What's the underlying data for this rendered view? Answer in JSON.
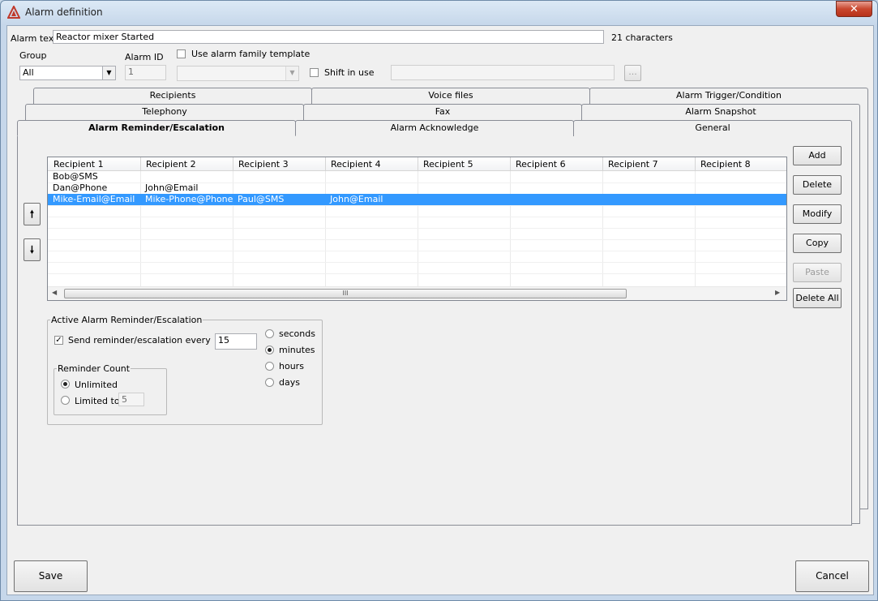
{
  "window": {
    "title": "Alarm definition",
    "close_symbol": "✕"
  },
  "alarm_text": {
    "label": "Alarm text",
    "value": "Reactor mixer Started",
    "char_count": "21 characters"
  },
  "group": {
    "label": "Group",
    "value": "All"
  },
  "alarm_id": {
    "label": "Alarm ID",
    "value": "1"
  },
  "family_template": {
    "label": "Use alarm family template",
    "checked": false,
    "value": ""
  },
  "shift": {
    "label": "Shift in use",
    "checked": false,
    "value": "",
    "browse_label": "..."
  },
  "tabs": {
    "row1": [
      "Recipients",
      "Voice files",
      "Alarm Trigger/Condition"
    ],
    "row2": [
      "Telephony",
      "Fax",
      "Alarm Snapshot"
    ],
    "row3": [
      "Alarm Reminder/Escalation",
      "Alarm Acknowledge",
      "General"
    ],
    "active": "Alarm Reminder/Escalation"
  },
  "recipients_grid": {
    "columns": [
      "Recipient 1",
      "Recipient 2",
      "Recipient 3",
      "Recipient 4",
      "Recipient 5",
      "Recipient 6",
      "Recipient 7",
      "Recipient 8"
    ],
    "rows": [
      [
        "Bob@SMS",
        "",
        "",
        "",
        "",
        "",
        "",
        ""
      ],
      [
        "Dan@Phone",
        "John@Email",
        "",
        "",
        "",
        "",
        "",
        ""
      ],
      [
        "Mike-Email@Email",
        "Mike-Phone@Phone",
        "Paul@SMS",
        "John@Email",
        "",
        "",
        "",
        ""
      ]
    ],
    "selected_row": 2,
    "scroll_grip": "III"
  },
  "move_buttons": {
    "up_symbol": "🠕",
    "down_symbol": "🠗"
  },
  "side_buttons": {
    "add": "Add",
    "delete": "Delete",
    "modify": "Modify",
    "copy": "Copy",
    "paste": "Paste",
    "delete_all": "Delete All"
  },
  "reminder": {
    "group_label": "Active Alarm Reminder/Escalation",
    "send_label": "Send reminder/escalation every",
    "send_checked": true,
    "interval_value": "15",
    "units": [
      "seconds",
      "minutes",
      "hours",
      "days"
    ],
    "selected_unit": "minutes",
    "count_group_label": "Reminder Count",
    "unlimited_label": "Unlimited",
    "limited_label": "Limited to",
    "selected_count": "Unlimited",
    "limit_value": "5"
  },
  "footer": {
    "save": "Save",
    "cancel": "Cancel"
  },
  "colors": {
    "selection": "#3399ff",
    "close_button": "#c9472e",
    "title_icon": "#c0392b"
  }
}
